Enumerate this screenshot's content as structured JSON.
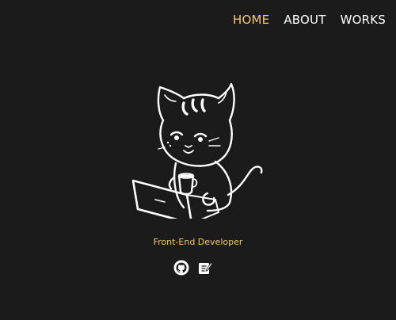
{
  "nav": {
    "items": [
      {
        "label": "HOME",
        "active": true
      },
      {
        "label": "ABOUT",
        "active": false
      },
      {
        "label": "WORKS",
        "active": false
      }
    ]
  },
  "hero": {
    "illustration": "cat-with-laptop-icon"
  },
  "tagline": "Front-End Developer",
  "socials": [
    {
      "icon": "github-icon"
    },
    {
      "icon": "edit-note-icon"
    }
  ],
  "colors": {
    "background": "#1b1b1b",
    "accent": "#f5c86e",
    "text": "#ffffff"
  }
}
